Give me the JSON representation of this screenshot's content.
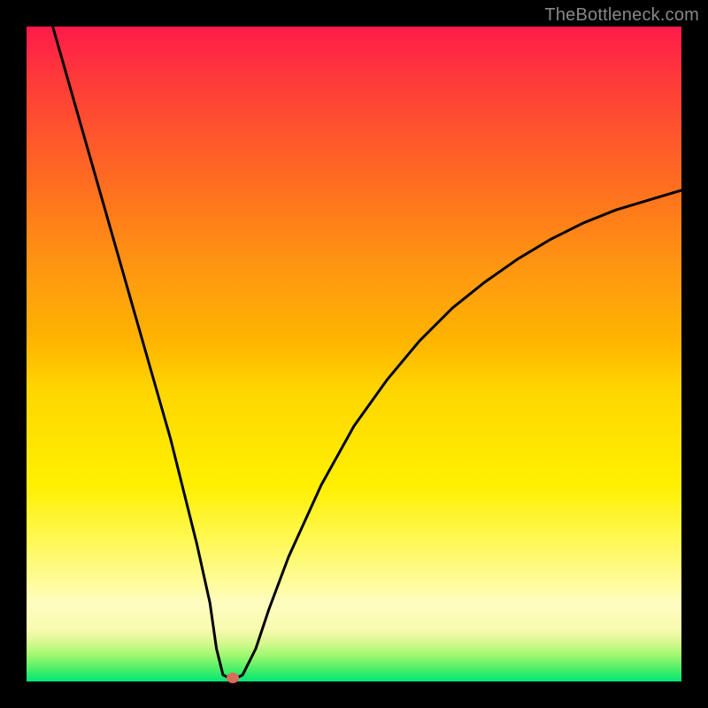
{
  "watermark": "TheBottleneck.com",
  "chart_data": {
    "type": "line",
    "title": "",
    "xlabel": "",
    "ylabel": "",
    "xlim": [
      0,
      100
    ],
    "ylim": [
      0,
      100
    ],
    "background_gradient": {
      "top": "#ff1a4a",
      "middle": "#ffe400",
      "bottom": "#00e676",
      "meaning": "red (high bottleneck) to green (low bottleneck)"
    },
    "series": [
      {
        "name": "bottleneck-curve",
        "color": "#000000",
        "x": [
          4,
          6,
          8,
          10,
          12,
          14,
          16,
          18,
          20,
          22,
          24,
          26,
          28,
          29,
          30,
          31,
          32,
          33,
          35,
          37,
          40,
          45,
          50,
          55,
          60,
          65,
          70,
          75,
          80,
          85,
          90,
          95,
          100
        ],
        "y": [
          100,
          93,
          86,
          79,
          72,
          65,
          58,
          51,
          44,
          37,
          29,
          21,
          12,
          5,
          1,
          0.5,
          0.5,
          1,
          5,
          11,
          19,
          30,
          39,
          46,
          52,
          57,
          61,
          64.5,
          67.5,
          70,
          72,
          73.5,
          75
        ]
      }
    ],
    "marker": {
      "name": "optimal-point",
      "x": 31.5,
      "y": 0.5,
      "color": "#d96b5a"
    }
  }
}
